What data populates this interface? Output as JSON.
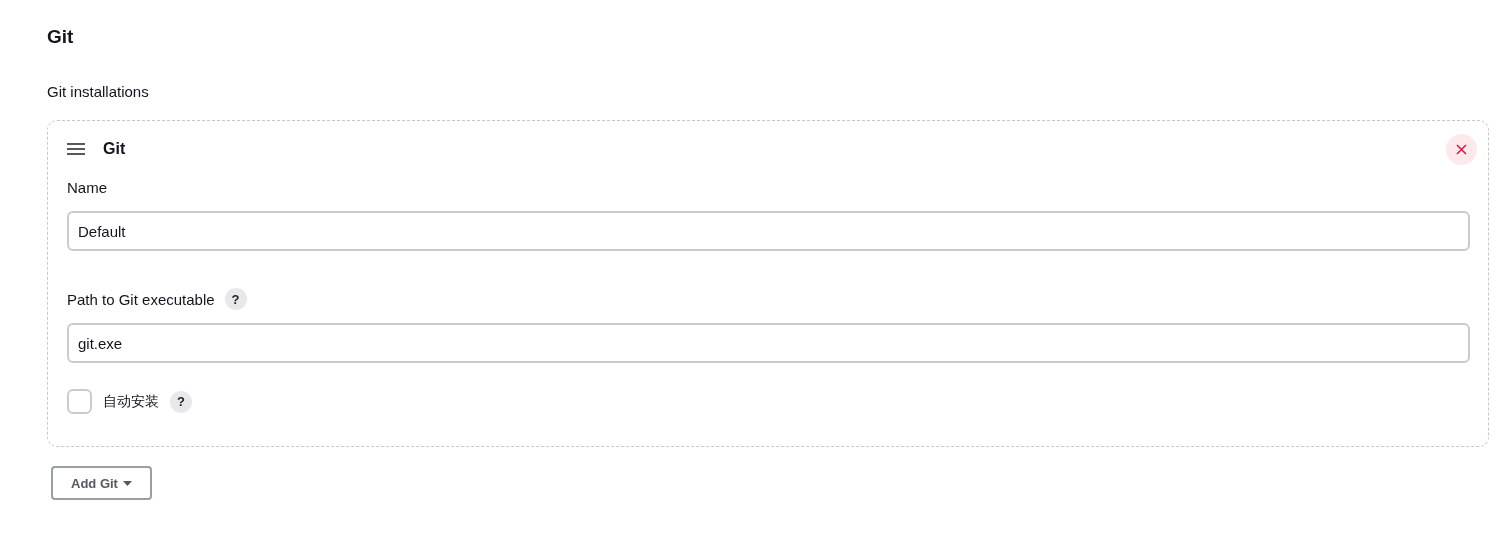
{
  "section_title": "Git",
  "list_label": "Git installations",
  "installations": [
    {
      "title": "Git",
      "fields": [
        {
          "kind": "text",
          "label": "Name",
          "value": "Default"
        },
        {
          "kind": "text",
          "label": "Path to Git executable",
          "help": "?",
          "value": "git.exe"
        },
        {
          "kind": "checkbox",
          "label": "自动安装",
          "help": "?",
          "checked": false
        }
      ]
    }
  ],
  "add_button": {
    "label": "Add Git"
  }
}
